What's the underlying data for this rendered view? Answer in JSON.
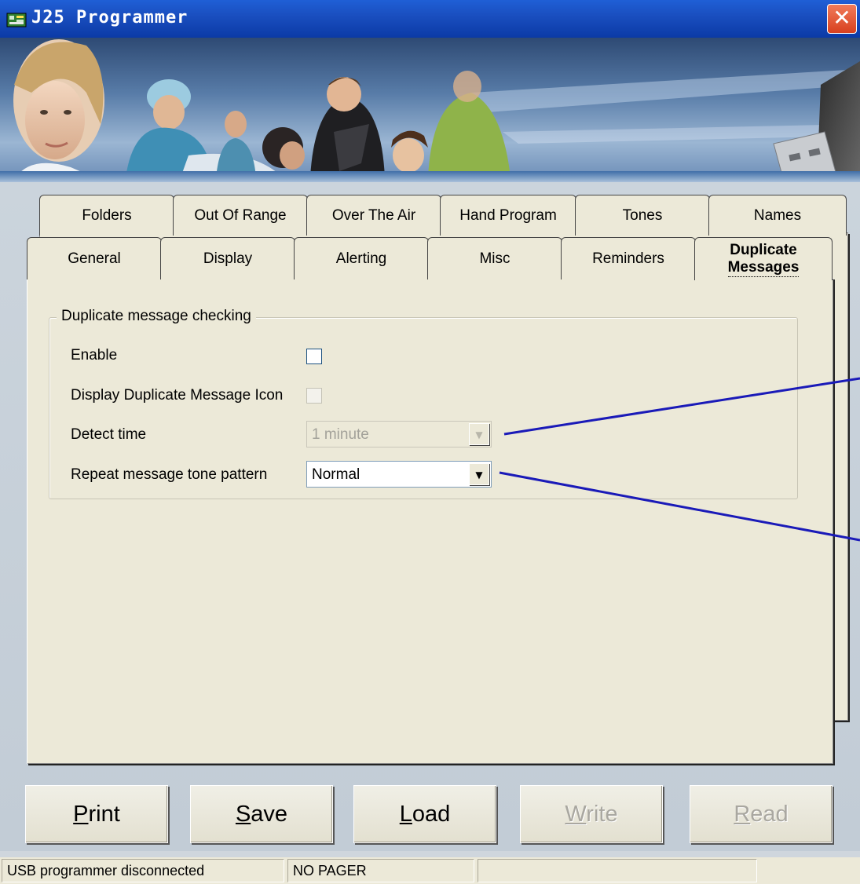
{
  "window": {
    "title": "J25 Programmer",
    "close_glyph": "✕",
    "icon_name": "app-icon"
  },
  "tabs": {
    "row1": [
      "Folders",
      "Out Of Range",
      "Over The Air",
      "Hand Program",
      "Tones",
      "Names"
    ],
    "row2": [
      "General",
      "Display",
      "Alerting",
      "Misc",
      "Reminders"
    ],
    "active": {
      "line1": "Duplicate",
      "line2": "Messages"
    }
  },
  "group": {
    "title": "Duplicate message checking",
    "enable_label": "Enable",
    "enable_checked": false,
    "display_icon_label": "Display Duplicate Message Icon",
    "display_icon_checked": false,
    "detect_time_label": "Detect time",
    "detect_time_value": "1 minute",
    "tone_label": "Repeat message tone pattern",
    "tone_value": "Normal"
  },
  "buttons": {
    "print": {
      "hotkey": "P",
      "rest": "rint"
    },
    "save": {
      "hotkey": "S",
      "rest": "ave"
    },
    "load": {
      "hotkey": "L",
      "rest": "oad"
    },
    "write": {
      "hotkey": "W",
      "rest": "rite"
    },
    "read": {
      "hotkey": "R",
      "rest": "ead"
    }
  },
  "status": {
    "connection": "USB programmer disconnected",
    "pager": "NO PAGER",
    "extra": ""
  },
  "colors": {
    "titlebar": "#0b3aa6",
    "callout_line": "#1a1ab8",
    "dialog_face": "#ece9d8"
  }
}
